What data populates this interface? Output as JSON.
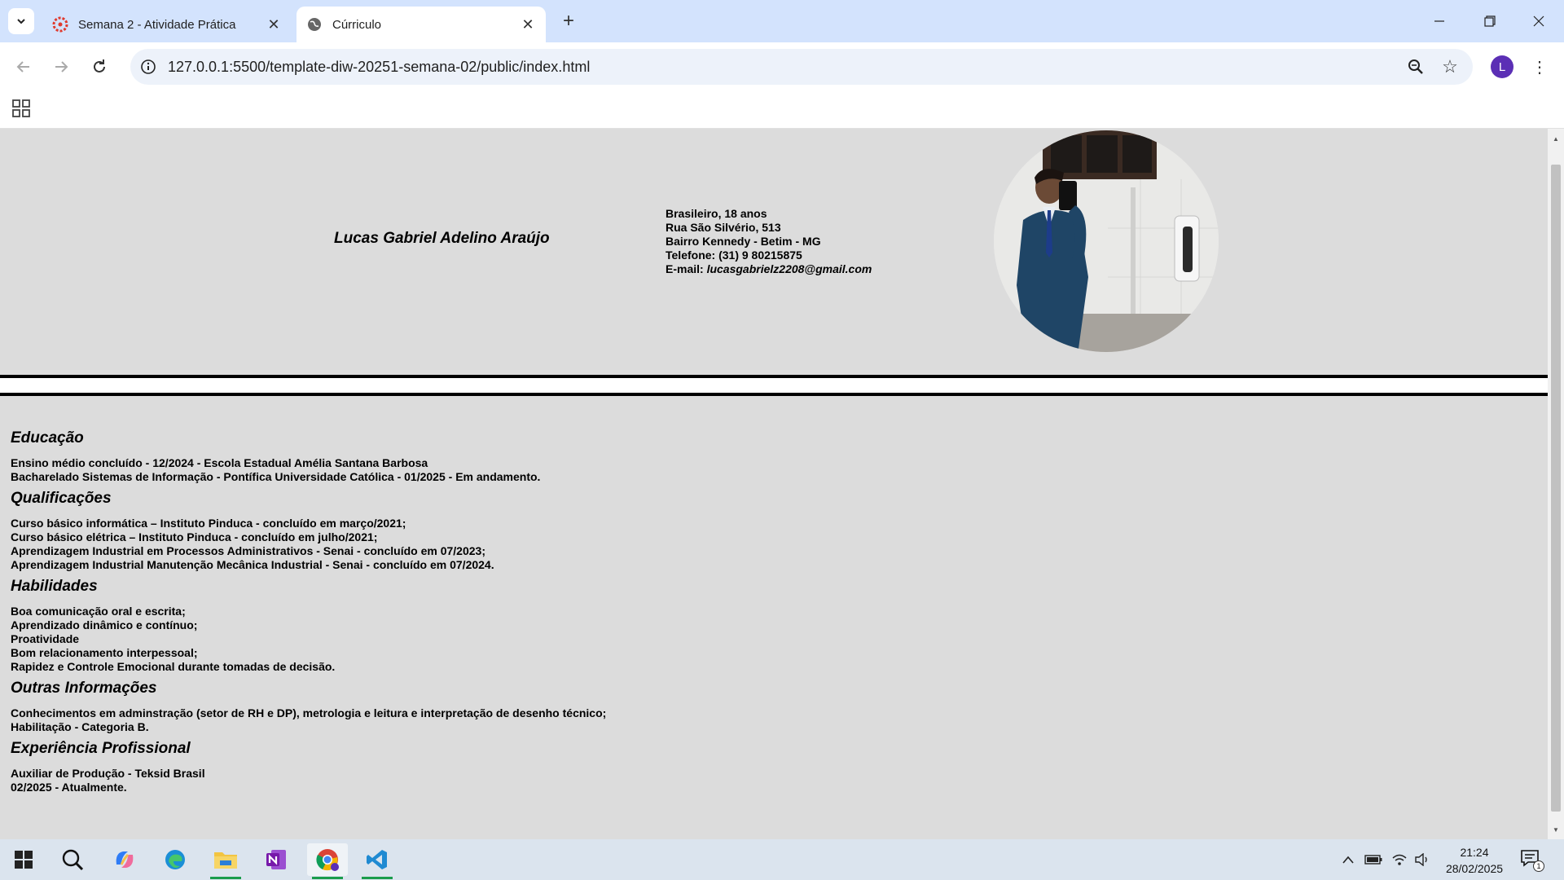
{
  "browser": {
    "tabs": [
      {
        "title": "Semana 2 - Atividade Prática",
        "active": false,
        "icon": "canvas-logo-icon"
      },
      {
        "title": "Cúrriculo",
        "active": true,
        "icon": "globe-icon"
      }
    ],
    "url": "127.0.0.1:5500/template-diw-20251-semana-02/public/index.html",
    "profile_initial": "L"
  },
  "page": {
    "name": "Lucas Gabriel Adelino Araújo",
    "contact": {
      "line1": "Brasileiro, 18 anos",
      "line2": "Rua São Silvério, 513",
      "line3": "Bairro Kennedy - Betim - MG",
      "line4": "Telefone: (31) 9 80215875",
      "email_label": "E-mail: ",
      "email_value": "lucasgabrielz2208@gmail.com"
    },
    "sections": {
      "educacao": {
        "title": "Educação",
        "items": [
          "Ensino médio concluído - 12/2024 - Escola Estadual Amélia Santana Barbosa",
          "Bacharelado Sistemas de Informação - Pontífica Universidade Católica - 01/2025 - Em andamento."
        ]
      },
      "qualificacoes": {
        "title": "Qualificações",
        "items": [
          "Curso básico informática – Instituto Pinduca - concluído em março/2021;",
          "Curso básico elétrica – Instituto Pinduca - concluído em julho/2021;",
          "Aprendizagem Industrial em Processos Administrativos - Senai - concluído em 07/2023;",
          "Aprendizagem Industrial Manutenção Mecânica Industrial - Senai - concluído em 07/2024."
        ]
      },
      "habilidades": {
        "title": "Habilidades",
        "items": [
          "Boa comunicação oral e escrita;",
          "Aprendizado dinâmico e contínuo;",
          "Proatividade",
          "Bom relacionamento interpessoal;",
          "Rapidez e Controle Emocional durante tomadas de decisão."
        ]
      },
      "outras": {
        "title": "Outras Informações",
        "items": [
          "Conhecimentos em adminstração (setor de RH e DP), metrologia e leitura e interpretação de desenho técnico;",
          "Habilitação - Categoria B."
        ]
      },
      "experiencia": {
        "title": "Experiência Profissional",
        "items": [
          "Auxiliar de Produção - Teksid Brasil",
          "02/2025 - Atualmente."
        ]
      }
    }
  },
  "taskbar": {
    "apps": [
      "windows-start-icon",
      "search-icon",
      "copilot-icon",
      "edge-icon",
      "file-explorer-icon",
      "onenote-icon",
      "chrome-icon",
      "vscode-icon"
    ],
    "time": "21:24",
    "date": "28/02/2025",
    "notification_count": "1"
  },
  "colors": {
    "tabstrip": "#d3e3fd",
    "page_bg": "#dcdcdc",
    "profile": "#5b2fb5",
    "taskbar": "#dbe4ee"
  }
}
